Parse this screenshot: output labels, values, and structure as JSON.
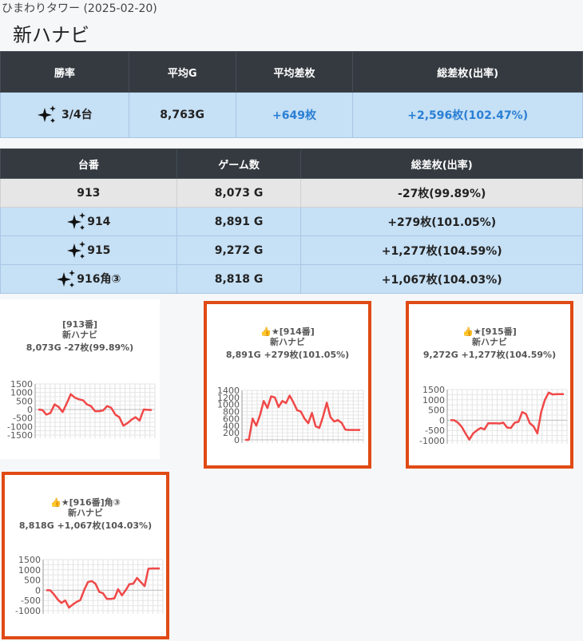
{
  "header": {
    "subtitle": "ひまわりタワー (2025-02-20)",
    "title": "新ハナビ"
  },
  "summary": {
    "headers": [
      "勝率",
      "平均G",
      "平均差枚",
      "総差枚(出率)"
    ],
    "win_rate": "3/4台",
    "avg_games": "8,763G",
    "avg_diff": "+649枚",
    "total_diff": "+2,596枚(102.47%)"
  },
  "machines": {
    "headers": [
      "台番",
      "ゲーム数",
      "総差枚(出率)"
    ],
    "rows": [
      {
        "number": "913",
        "games": "8,073 G",
        "diff": "-27枚(99.89%)",
        "winner": false
      },
      {
        "number": "914",
        "games": "8,891 G",
        "diff": "+279枚(101.05%)",
        "winner": true
      },
      {
        "number": "915",
        "games": "9,272 G",
        "diff": "+1,277枚(104.59%)",
        "winner": true
      },
      {
        "number": "916角③",
        "games": "8,818 G",
        "diff": "+1,067枚(104.03%)",
        "winner": true
      }
    ]
  },
  "colors": {
    "header_bg": "#343a40",
    "row_blue": "#c6e0f5",
    "row_gray": "#e6e6e6",
    "accent_blue": "#2a7fd4",
    "highlight_border": "#e04a14",
    "line_red": "#f04848"
  },
  "chart_data": [
    {
      "type": "line",
      "title": "[913番]",
      "subtitle_1": "新ハナビ",
      "subtitle_2": "8,073G -27枚(99.89%)",
      "y_ticks": [
        1500,
        1000,
        500,
        0,
        -500,
        -1000,
        -1500
      ],
      "ylim": [
        -1500,
        1500
      ],
      "values": [
        0,
        -30,
        -300,
        -200,
        300,
        150,
        -150,
        350,
        900,
        700,
        600,
        550,
        300,
        200,
        -100,
        -100,
        -50,
        200,
        100,
        -300,
        -450,
        -950,
        -800,
        -600,
        -450,
        -650,
        0,
        -20,
        -30
      ]
    },
    {
      "type": "line",
      "title": "👍★[914番]",
      "subtitle_1": "新ハナビ",
      "subtitle_2": "8,891G +279枚(101.05%)",
      "y_ticks": [
        1400,
        1200,
        1000,
        800,
        600,
        400,
        200,
        0
      ],
      "ylim": [
        0,
        1400
      ],
      "values": [
        0,
        0,
        600,
        400,
        700,
        1100,
        900,
        1230,
        1200,
        930,
        1100,
        1040,
        1250,
        1060,
        840,
        800,
        600,
        470,
        760,
        380,
        340,
        660,
        1050,
        640,
        520,
        560,
        480,
        290,
        280,
        280,
        280,
        280
      ]
    },
    {
      "type": "line",
      "title": "👍★[915番]",
      "subtitle_1": "新ハナビ",
      "subtitle_2": "9,272G +1,277枚(104.59%)",
      "y_ticks": [
        1500,
        1000,
        500,
        0,
        -500,
        -1000
      ],
      "ylim": [
        -1000,
        1500
      ],
      "values": [
        0,
        0,
        -120,
        -330,
        -650,
        -950,
        -650,
        -500,
        -380,
        -450,
        -150,
        -150,
        -150,
        -160,
        -120,
        -360,
        -380,
        -120,
        -80,
        400,
        300,
        -150,
        -300,
        -650,
        400,
        1000,
        1350,
        1260,
        1277,
        1277,
        1277
      ]
    },
    {
      "type": "line",
      "title": "👍★[916番]角③",
      "subtitle_1": "新ハナビ",
      "subtitle_2": "8,818G +1,067枚(104.03%)",
      "y_ticks": [
        1500,
        1000,
        500,
        0,
        -500,
        -1000
      ],
      "ylim": [
        -1000,
        1500
      ],
      "values": [
        0,
        0,
        -200,
        -450,
        -620,
        -500,
        -850,
        -700,
        -570,
        -480,
        0,
        400,
        450,
        320,
        -80,
        -150,
        -420,
        -420,
        -400,
        50,
        -250,
        0,
        300,
        320,
        600,
        400,
        200,
        1050,
        1067,
        1067,
        1067
      ]
    }
  ]
}
